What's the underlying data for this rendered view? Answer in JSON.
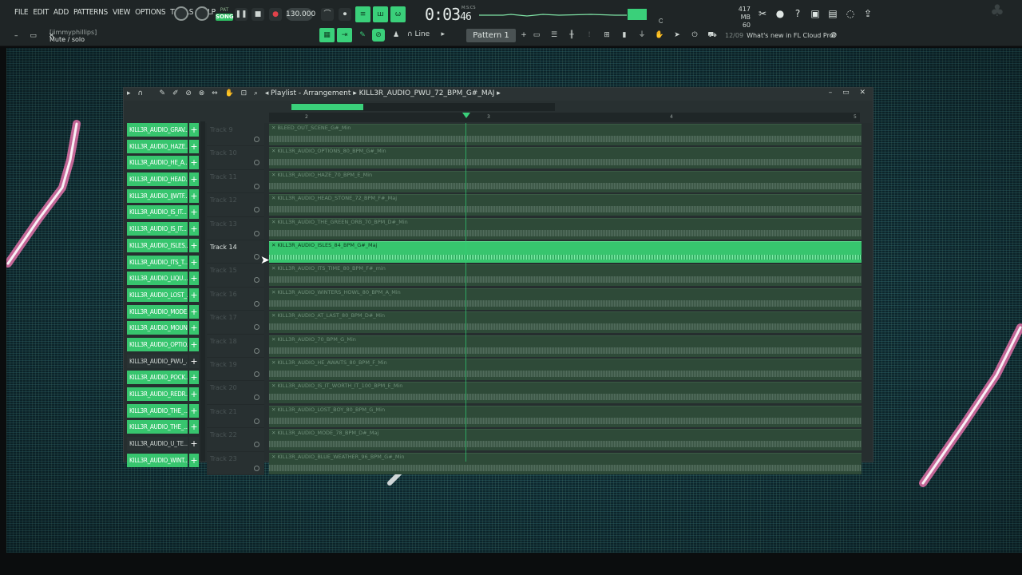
{
  "menu": [
    "FILE",
    "EDIT",
    "ADD",
    "PATTERNS",
    "VIEW",
    "OPTIONS",
    "TOOLS",
    "HELP"
  ],
  "transport": {
    "pat_label": "PAT",
    "song_label": "SONG",
    "tempo": "130.000",
    "time_main": "0:03",
    "time_small": "46",
    "time_unit": "M:S:CS",
    "memory_mb": "417 MB",
    "memory_num": "60"
  },
  "hint": {
    "user": "[jimmyphillips]",
    "text": "Mute / solo"
  },
  "toolbar2": {
    "snap": "Line",
    "pattern": "Pattern 1",
    "news_count": "12/09",
    "news_text": "What's new in FL Cloud Pro?"
  },
  "playlist": {
    "title": "Playlist - Arrangement",
    "crumb": "KILL3R_AUDIO_PWU_72_BPM_G#_MAJ",
    "ruler": [
      "2",
      "3",
      "4",
      "5"
    ]
  },
  "channels": [
    {
      "label": "KILL3R_AUDIO_GRAV...",
      "on": true
    },
    {
      "label": "KILL3R_AUDIO_HAZE...",
      "on": true
    },
    {
      "label": "KILL3R_AUDIO_HE_A...",
      "on": true
    },
    {
      "label": "KILL3R_AUDIO_HEAD...",
      "on": true
    },
    {
      "label": "KILL3R_AUDIO_IJWTF...",
      "on": true
    },
    {
      "label": "KILL3R_AUDIO_IS_IT...",
      "on": true
    },
    {
      "label": "KILL3R_AUDIO_IS_IT...",
      "on": true
    },
    {
      "label": "KILL3R_AUDIO_ISLES...",
      "on": true
    },
    {
      "label": "KILL3R_AUDIO_ITS_T...",
      "on": true
    },
    {
      "label": "KILL3R_AUDIO_LIQU...",
      "on": true
    },
    {
      "label": "KILL3R_AUDIO_LOST_...",
      "on": true
    },
    {
      "label": "KILL3R_AUDIO_MODE...",
      "on": true
    },
    {
      "label": "KILL3R_AUDIO_MOUN...",
      "on": true
    },
    {
      "label": "KILL3R_AUDIO_OPTIO...",
      "on": true
    },
    {
      "label": "KILL3R_AUDIO_PWU_...",
      "on": false
    },
    {
      "label": "KILL3R_AUDIO_POCK...",
      "on": true
    },
    {
      "label": "KILL3R_AUDIO_REDR...",
      "on": true
    },
    {
      "label": "KILL3R_AUDIO_THE_...",
      "on": true
    },
    {
      "label": "KILL3R_AUDIO_THE_...",
      "on": true
    },
    {
      "label": "KILL3R_AUDIO_U_TE...",
      "on": false
    },
    {
      "label": "KILL3R_AUDIO_WINT...",
      "on": true
    }
  ],
  "tracks": [
    {
      "name": "Track 9",
      "clip": "BLEED_OUT_SCENE_G#_Min",
      "active": false
    },
    {
      "name": "Track 10",
      "clip": "KILL3R_AUDIO_OPTIONS_80_BPM_G#_Min",
      "active": false
    },
    {
      "name": "Track 11",
      "clip": "KILL3R_AUDIO_HAZE_70_BPM_E_Min",
      "active": false
    },
    {
      "name": "Track 12",
      "clip": "KILL3R_AUDIO_HEAD_STONE_72_BPM_F#_Maj",
      "active": false
    },
    {
      "name": "Track 13",
      "clip": "KILL3R_AUDIO_THE_GREEN_ORB_70_BPM_D#_Min",
      "active": false
    },
    {
      "name": "Track 14",
      "clip": "KILL3R_AUDIO_ISLES_84_BPM_G#_Maj",
      "active": true
    },
    {
      "name": "Track 15",
      "clip": "KILL3R_AUDIO_ITS_TIME_80_BPM_F#_min",
      "active": false
    },
    {
      "name": "Track 16",
      "clip": "KILL3R_AUDIO_WINTERS_HOWL_80_BPM_A_Min",
      "active": false
    },
    {
      "name": "Track 17",
      "clip": "KILL3R_AUDIO_AT_LAST_80_BPM_D#_Min",
      "active": false
    },
    {
      "name": "Track 18",
      "clip": "KILL3R_AUDIO_70_BPM_G_Min",
      "active": false
    },
    {
      "name": "Track 19",
      "clip": "KILL3R_AUDIO_HE_AWAITS_80_BPM_F_Min",
      "active": false
    },
    {
      "name": "Track 20",
      "clip": "KILL3R_AUDIO_IS_IT_WORTH_IT_100_BPM_E_Min",
      "active": false
    },
    {
      "name": "Track 21",
      "clip": "KILL3R_AUDIO_LOST_BOY_80_BPM_G_Min",
      "active": false
    },
    {
      "name": "Track 22",
      "clip": "KILL3R_AUDIO_MODE_78_BPM_D#_Maj",
      "active": false
    },
    {
      "name": "Track 23",
      "clip": "KILL3R_AUDIO_BLUE_WEATHER_96_BPM_G#_Min",
      "active": false
    }
  ],
  "colors": {
    "accent": "#37c56e",
    "panel": "#262e2f",
    "toolbar": "#1f2526"
  }
}
